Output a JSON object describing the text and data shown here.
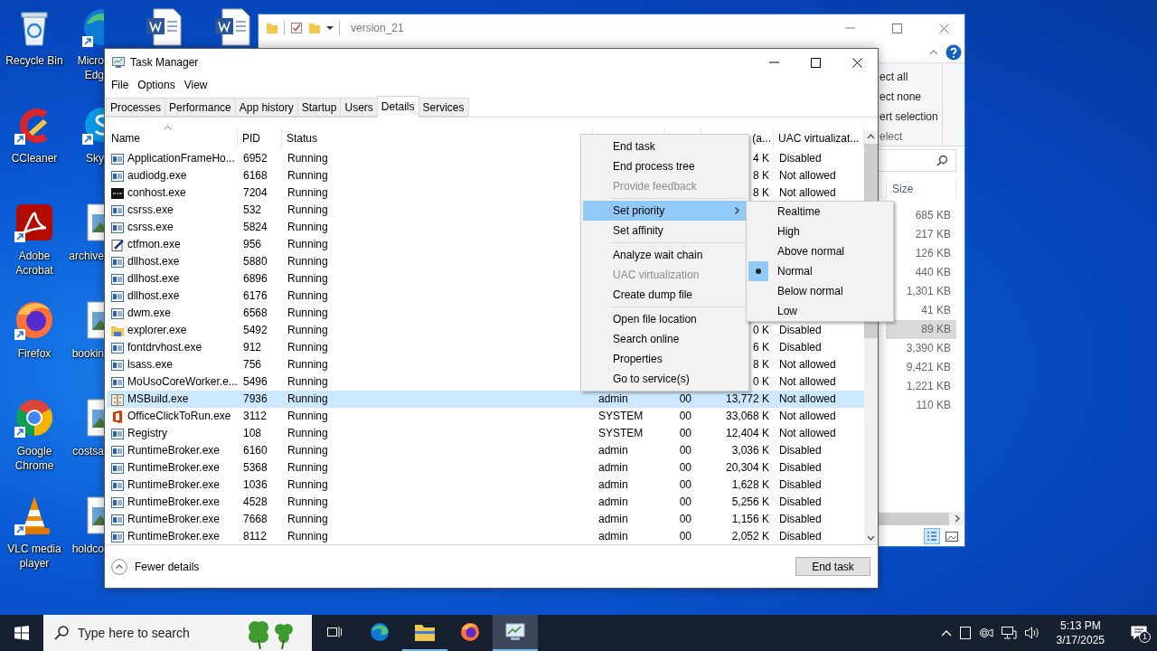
{
  "desktop": {
    "columns": [
      {
        "icons": [
          {
            "label": [
              "Recycle Bin"
            ],
            "kind": "recycle",
            "shortcut": false
          },
          {
            "label": [
              "CCleaner"
            ],
            "kind": "ccleaner",
            "shortcut": true
          },
          {
            "label": [
              "Adobe",
              "Acrobat"
            ],
            "kind": "acrobat",
            "shortcut": true
          },
          {
            "label": [
              "Firefox"
            ],
            "kind": "firefox",
            "shortcut": true
          },
          {
            "label": [
              "Google",
              "Chrome"
            ],
            "kind": "chrome",
            "shortcut": true
          },
          {
            "label": [
              "VLC media",
              "player"
            ],
            "kind": "vlc",
            "shortcut": true
          }
        ]
      },
      {
        "icons": [
          {
            "label": [
              "Micro",
              "Edg"
            ],
            "kind": "edge",
            "shortcut": true
          },
          {
            "label": [
              "Sky"
            ],
            "kind": "skype",
            "shortcut": true
          },
          {
            "label": [
              "archive"
            ],
            "kind": "image",
            "shortcut": false
          },
          {
            "label": [
              "bookin"
            ],
            "kind": "image",
            "shortcut": false
          },
          {
            "label": [
              "costsa"
            ],
            "kind": "image",
            "shortcut": false
          },
          {
            "label": [
              "holdco"
            ],
            "kind": "image",
            "shortcut": false
          }
        ]
      },
      {
        "icons": [
          {
            "kind": "word",
            "shortcut": false
          }
        ]
      },
      {
        "icons": [
          {
            "kind": "word",
            "shortcut": false
          }
        ]
      }
    ]
  },
  "explorer": {
    "title": "version_21",
    "ribbon": {
      "commands": [
        "ect all",
        "ect none",
        "ert selection"
      ],
      "group_label": "elect"
    },
    "columns": [
      "Size"
    ],
    "files": [
      {
        "size": "685 KB",
        "selected": false
      },
      {
        "size": "217 KB",
        "selected": false
      },
      {
        "size": "126 KB",
        "selected": false
      },
      {
        "size": "440 KB",
        "selected": false
      },
      {
        "size": "1,301 KB",
        "selected": false
      },
      {
        "size": "41 KB",
        "selected": false
      },
      {
        "size": "89 KB",
        "selected": true
      },
      {
        "size": "3,390 KB",
        "selected": false
      },
      {
        "size": "9,421 KB",
        "selected": false
      },
      {
        "size": "1,221 KB",
        "selected": false
      },
      {
        "size": "110 KB",
        "selected": false
      }
    ],
    "view_buttons": [
      {
        "kind": "details",
        "selected": true
      },
      {
        "kind": "thumbnails",
        "selected": false
      }
    ]
  },
  "task_manager": {
    "title": "Task Manager",
    "menu": [
      "File",
      "Options",
      "View"
    ],
    "tabs": [
      {
        "label": "Processes",
        "selected": false
      },
      {
        "label": "Performance",
        "selected": false
      },
      {
        "label": "App history",
        "selected": false
      },
      {
        "label": "Startup",
        "selected": false
      },
      {
        "label": "Users",
        "selected": false
      },
      {
        "label": "Details",
        "selected": true
      },
      {
        "label": "Services",
        "selected": false
      }
    ],
    "columns": [
      {
        "label": "Name",
        "sorted": true
      },
      {
        "label": "PID",
        "sorted": false
      },
      {
        "label": "Status",
        "sorted": false
      },
      {},
      {},
      {
        "label": "(a...",
        "sorted": false
      },
      {
        "label": "UAC virtualizat...",
        "sorted": false
      }
    ],
    "rows": [
      {
        "kind": "window",
        "name": "ApplicationFrameHo...",
        "pid": "6952",
        "status": "Running",
        "column_6": "4 K",
        "uac_virtualization": "Disabled",
        "selected": false
      },
      {
        "kind": "window",
        "name": "audiodg.exe",
        "pid": "6168",
        "status": "Running",
        "column_6": "8 K",
        "uac_virtualization": "Not allowed",
        "selected": false
      },
      {
        "kind": "console",
        "name": "conhost.exe",
        "pid": "7204",
        "status": "Running",
        "column_6": "8 K",
        "uac_virtualization": "Not allowed",
        "selected": false
      },
      {
        "kind": "window",
        "name": "csrss.exe",
        "pid": "532",
        "status": "Running",
        "selected": false
      },
      {
        "kind": "window",
        "name": "csrss.exe",
        "pid": "5824",
        "status": "Running",
        "selected": false
      },
      {
        "kind": "editor",
        "name": "ctfmon.exe",
        "pid": "956",
        "status": "Running",
        "selected": false
      },
      {
        "kind": "window",
        "name": "dllhost.exe",
        "pid": "5880",
        "status": "Running",
        "selected": false
      },
      {
        "kind": "window",
        "name": "dllhost.exe",
        "pid": "6896",
        "status": "Running",
        "selected": false
      },
      {
        "kind": "window",
        "name": "dllhost.exe",
        "pid": "6176",
        "status": "Running",
        "selected": false
      },
      {
        "kind": "window",
        "name": "dwm.exe",
        "pid": "6568",
        "status": "Running",
        "selected": false
      },
      {
        "kind": "explorer",
        "name": "explorer.exe",
        "pid": "5492",
        "status": "Running",
        "column_6": "0 K",
        "uac_virtualization": "Disabled",
        "selected": false
      },
      {
        "kind": "window",
        "name": "fontdrvhost.exe",
        "pid": "912",
        "status": "Running",
        "column_6": "6 K",
        "uac_virtualization": "Disabled",
        "selected": false
      },
      {
        "kind": "window",
        "name": "lsass.exe",
        "pid": "756",
        "status": "Running",
        "column_6": "8 K",
        "uac_virtualization": "Not allowed",
        "selected": false
      },
      {
        "kind": "window",
        "name": "MoUsoCoreWorker.e...",
        "pid": "5496",
        "status": "Running",
        "column_6": "0 K",
        "uac_virtualization": "Not allowed",
        "selected": false
      },
      {
        "kind": "build",
        "name": "MSBuild.exe",
        "pid": "7936",
        "status": "Running",
        "column_4": "admin",
        "column_5": "00",
        "column_6": "13,772 K",
        "uac_virtualization": "Not allowed",
        "selected": true
      },
      {
        "kind": "office",
        "name": "OfficeClickToRun.exe",
        "pid": "3112",
        "status": "Running",
        "column_4": "SYSTEM",
        "column_5": "00",
        "column_6": "33,068 K",
        "uac_virtualization": "Not allowed",
        "selected": false
      },
      {
        "kind": "window",
        "name": "Registry",
        "pid": "108",
        "status": "Running",
        "column_4": "SYSTEM",
        "column_5": "00",
        "column_6": "12,404 K",
        "uac_virtualization": "Not allowed",
        "selected": false
      },
      {
        "kind": "window",
        "name": "RuntimeBroker.exe",
        "pid": "6160",
        "status": "Running",
        "column_4": "admin",
        "column_5": "00",
        "column_6": "3,036 K",
        "uac_virtualization": "Disabled",
        "selected": false
      },
      {
        "kind": "window",
        "name": "RuntimeBroker.exe",
        "pid": "5368",
        "status": "Running",
        "column_4": "admin",
        "column_5": "00",
        "column_6": "20,304 K",
        "uac_virtualization": "Disabled",
        "selected": false
      },
      {
        "kind": "window",
        "name": "RuntimeBroker.exe",
        "pid": "1036",
        "status": "Running",
        "column_4": "admin",
        "column_5": "00",
        "column_6": "1,628 K",
        "uac_virtualization": "Disabled",
        "selected": false
      },
      {
        "kind": "window",
        "name": "RuntimeBroker.exe",
        "pid": "4528",
        "status": "Running",
        "column_4": "admin",
        "column_5": "00",
        "column_6": "5,256 K",
        "uac_virtualization": "Disabled",
        "selected": false
      },
      {
        "kind": "window",
        "name": "RuntimeBroker.exe",
        "pid": "7668",
        "status": "Running",
        "column_4": "admin",
        "column_5": "00",
        "column_6": "1,156 K",
        "uac_virtualization": "Disabled",
        "selected": false
      },
      {
        "kind": "window",
        "name": "RuntimeBroker.exe",
        "pid": "8112",
        "status": "Running",
        "column_4": "admin",
        "column_5": "00",
        "column_6": "2,052 K",
        "uac_virtualization": "Disabled",
        "selected": false
      }
    ],
    "fewer_details": "Fewer details",
    "end_task": "End task",
    "context_menu": {
      "groups": [
        [
          {
            "label": "End task",
            "disabled": false,
            "selected": false,
            "submenu": false
          },
          {
            "label": "End process tree",
            "disabled": false,
            "selected": false,
            "submenu": false
          },
          {
            "label": "Provide feedback",
            "disabled": true,
            "selected": false,
            "submenu": false
          }
        ],
        [
          {
            "label": "Set priority",
            "disabled": false,
            "selected": true,
            "submenu": true
          },
          {
            "label": "Set affinity",
            "disabled": false,
            "selected": false,
            "submenu": false
          }
        ],
        [
          {
            "label": "Analyze wait chain",
            "disabled": false,
            "selected": false,
            "submenu": false
          },
          {
            "label": "UAC virtualization",
            "disabled": true,
            "selected": false,
            "submenu": false
          },
          {
            "label": "Create dump file",
            "disabled": false,
            "selected": false,
            "submenu": false
          }
        ],
        [
          {
            "label": "Open file location",
            "disabled": false,
            "selected": false,
            "submenu": false
          },
          {
            "label": "Search online",
            "disabled": false,
            "selected": false,
            "submenu": false
          },
          {
            "label": "Properties",
            "disabled": false,
            "selected": false,
            "submenu": false
          },
          {
            "label": "Go to service(s)",
            "disabled": false,
            "selected": false,
            "submenu": false
          }
        ]
      ]
    },
    "priority_menu": [
      {
        "label": "Realtime",
        "checked": false
      },
      {
        "label": "High",
        "checked": false
      },
      {
        "label": "Above normal",
        "checked": false
      },
      {
        "label": "Normal",
        "checked": true
      },
      {
        "label": "Below normal",
        "checked": false
      },
      {
        "label": "Low",
        "checked": false
      }
    ]
  },
  "taskbar": {
    "search": {
      "placeholder": "Type here to search"
    },
    "apps": [
      {
        "kind": "edge",
        "running": false,
        "selected": false
      },
      {
        "kind": "explorer",
        "running": true,
        "selected": false
      },
      {
        "kind": "firefox",
        "running": false,
        "selected": false
      },
      {
        "kind": "taskmanager",
        "running": true,
        "selected": true
      }
    ],
    "time": "5:13 PM",
    "date": "3/17/2025",
    "notification_count": "1"
  }
}
